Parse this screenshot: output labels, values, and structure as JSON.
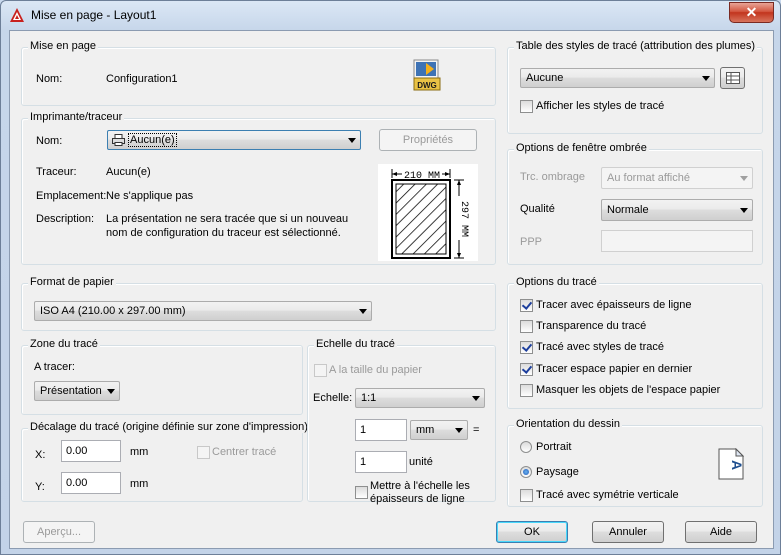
{
  "window": {
    "title": "Mise en page - Layout1",
    "close_glyph": "✕"
  },
  "mise_en_page": {
    "legend": "Mise en page",
    "name_label": "Nom:",
    "name_value": "Configuration1",
    "dwg_icon_text": "DWG"
  },
  "imprimante": {
    "legend": "Imprimante/traceur",
    "name_label": "Nom:",
    "name_value": "Aucun(e)",
    "properties_button": "Propriétés",
    "traceur_label": "Traceur:",
    "traceur_value": "Aucun(e)",
    "emplacement_label": "Emplacement:",
    "emplacement_value": "Ne s'applique pas",
    "description_label": "Description:",
    "description_line1": "La présentation ne sera tracée que si un nouveau",
    "description_line2": "nom de configuration du traceur est sélectionné.",
    "preview_width": "210 MM",
    "preview_height": "297 MM"
  },
  "format_papier": {
    "legend": "Format de papier",
    "value": "ISO A4 (210.00 x 297.00 mm)"
  },
  "zone_trace": {
    "legend": "Zone du tracé",
    "a_tracer_label": "A tracer:",
    "a_tracer_value": "Présentation"
  },
  "decalage": {
    "legend": "Décalage du tracé (origine définie sur zone d'impression)",
    "x_label": "X:",
    "x_value": "0.00",
    "x_unit": "mm",
    "y_label": "Y:",
    "y_value": "0.00",
    "y_unit": "mm",
    "center_label": "Centrer tracé"
  },
  "echelle": {
    "legend": "Echelle du tracé",
    "fit_label": "A la taille du papier",
    "scale_label": "Echelle:",
    "scale_value": "1:1",
    "value1": "1",
    "unit1": "mm",
    "equals": "=",
    "value2": "1",
    "unit2": "unité",
    "lineweights_line1": "Mettre à l'échelle les",
    "lineweights_line2": "épaisseurs de ligne"
  },
  "table_styles": {
    "legend": "Table des styles de tracé (attribution des plumes)",
    "value": "Aucune",
    "show_label": "Afficher les styles de tracé"
  },
  "fenetre_ombree": {
    "legend": "Options de fenêtre ombrée",
    "ombrage_label": "Trc. ombrage",
    "ombrage_value": "Au format affiché",
    "qualite_label": "Qualité",
    "qualite_value": "Normale",
    "ppp_label": "PPP"
  },
  "options_trace": {
    "legend": "Options du tracé",
    "items": [
      {
        "label": "Tracer avec épaisseurs de ligne",
        "checked": true
      },
      {
        "label": "Transparence du tracé",
        "checked": false
      },
      {
        "label": "Tracé avec styles de tracé",
        "checked": true
      },
      {
        "label": "Tracer espace papier en dernier",
        "checked": true
      },
      {
        "label": "Masquer les objets de l'espace papier",
        "checked": false
      }
    ]
  },
  "orientation": {
    "legend": "Orientation du dessin",
    "portrait": "Portrait",
    "paysage": "Paysage",
    "mirror": "Tracé avec symétrie verticale",
    "icon_letter": "A"
  },
  "buttons": {
    "preview": "Aperçu...",
    "ok": "OK",
    "cancel": "Annuler",
    "help": "Aide"
  },
  "colors": {
    "accent": "#3c7fb1",
    "title_close": "#c2341d",
    "frame": "#c3d3e8",
    "client": "#f0f0f0"
  }
}
